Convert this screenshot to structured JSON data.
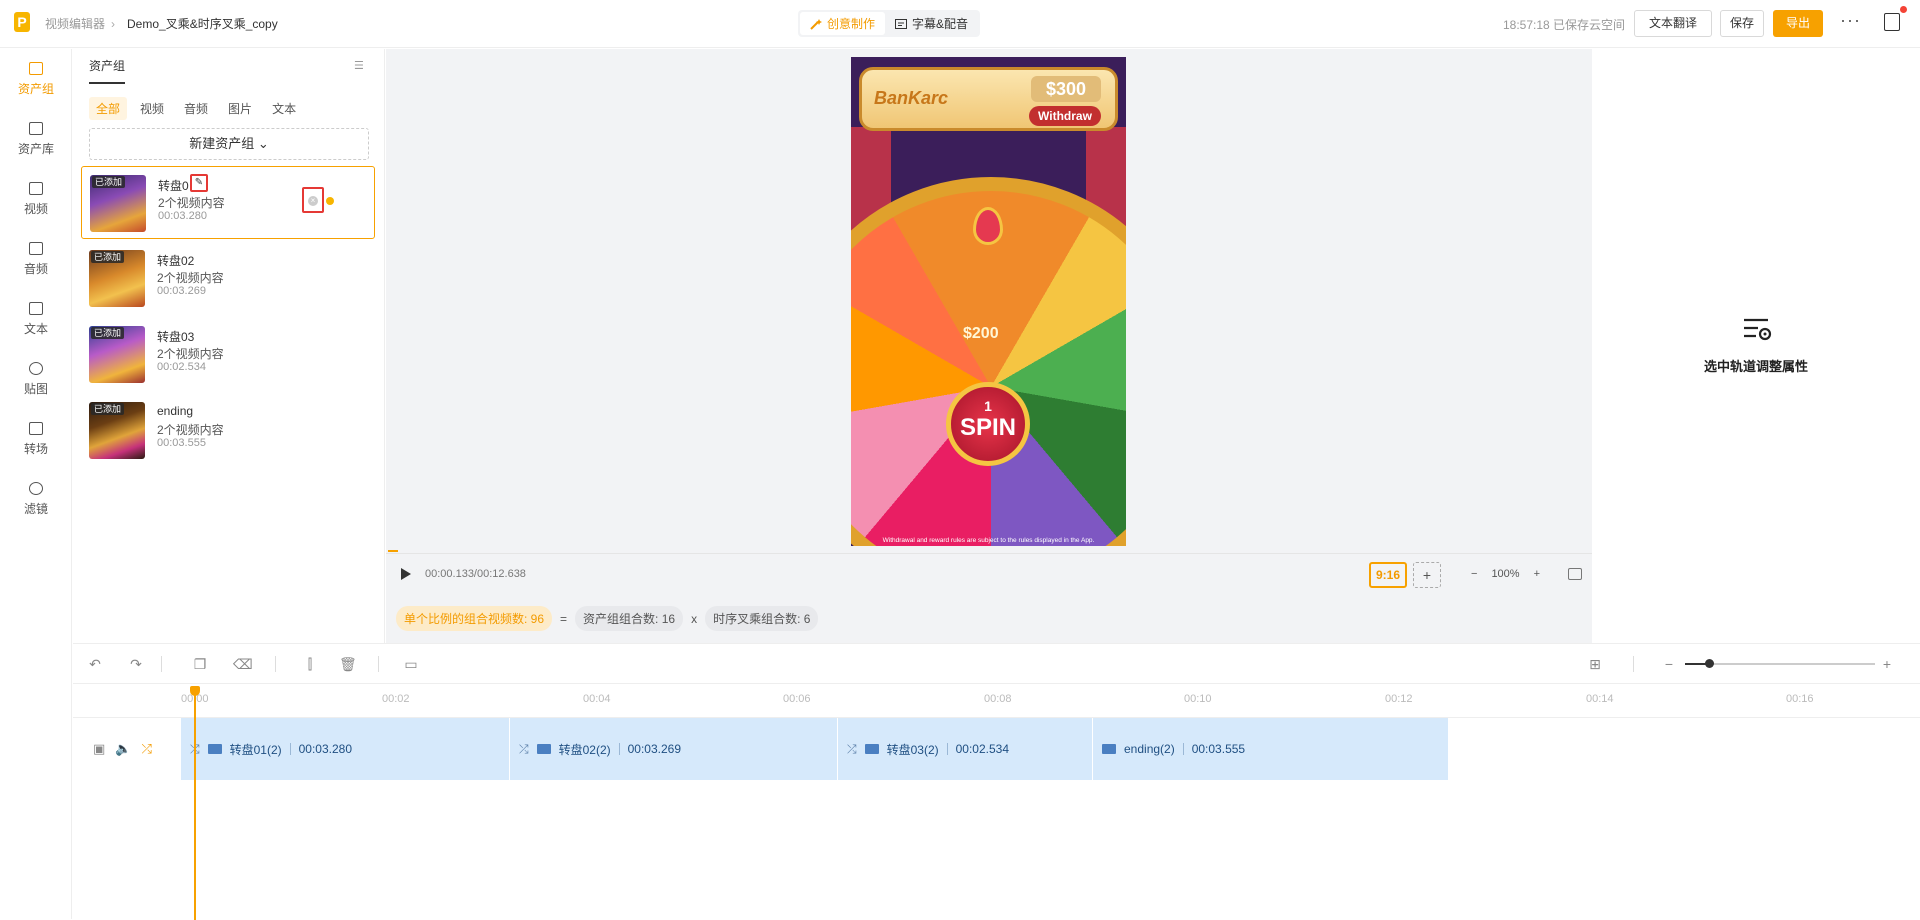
{
  "header": {
    "logo": "P",
    "breadcrumb_app": "视频编辑器",
    "project_name": "Demo_叉乘&时序叉乘_copy",
    "mode_tabs": [
      "创意制作",
      "字幕&配音"
    ],
    "active_mode": "创意制作",
    "save_status": "18:57:18 已保存云空间",
    "translate_label": "文本翻译",
    "save_label": "保存",
    "export_label": "导出",
    "more_label": "···"
  },
  "nav": {
    "items": [
      {
        "label": "资产组",
        "icon": "folder-icon",
        "active": true
      },
      {
        "label": "资产库",
        "icon": "media-library-icon"
      },
      {
        "label": "视频",
        "icon": "film-icon"
      },
      {
        "label": "音频",
        "icon": "music-icon"
      },
      {
        "label": "文本",
        "icon": "text-icon"
      },
      {
        "label": "贴图",
        "icon": "sticker-icon"
      },
      {
        "label": "转场",
        "icon": "transition-icon"
      },
      {
        "label": "滤镜",
        "icon": "filter-icon"
      }
    ]
  },
  "asset_panel": {
    "title": "资产组",
    "filters": [
      "全部",
      "视频",
      "音频",
      "图片",
      "文本"
    ],
    "active_filter": "全部",
    "new_group_label": "新建资产组",
    "assets": [
      {
        "badge": "已添加",
        "name": "转盘0",
        "subtitle": "2个视频内容",
        "duration": "00:03.280",
        "selected": true
      },
      {
        "badge": "已添加",
        "name": "转盘02",
        "subtitle": "2个视频内容",
        "duration": "00:03.269"
      },
      {
        "badge": "已添加",
        "name": "转盘03",
        "subtitle": "2个视频内容",
        "duration": "00:02.534"
      },
      {
        "badge": "已添加",
        "name": "ending",
        "subtitle": "2个视频内容",
        "duration": "00:03.555"
      }
    ]
  },
  "preview": {
    "brand": "BanKarc",
    "amount": "$300",
    "withdraw": "Withdraw",
    "prize": "$200",
    "spin_count": "1",
    "spin_label": "SPIN",
    "footer": "Withdrawal and reward rules are subject to the rules displayed in the App."
  },
  "player": {
    "timecode": "00:00.133/00:12.638",
    "ratio": "9:16",
    "ratio_add": "+",
    "zoom": "100%",
    "zoom_minus": "−",
    "zoom_plus": "+"
  },
  "combo": {
    "total_label": "单个比例的组合视频数: 96",
    "eq": "=",
    "group_label": "资产组组合数: 16",
    "times": "x",
    "seq_label": "时序叉乘组合数: 6"
  },
  "right_panel": {
    "hint": "选中轨道调整属性"
  },
  "timeline": {
    "ticks": [
      "00:00",
      "00:02",
      "00:04",
      "00:06",
      "00:08",
      "00:10",
      "00:12",
      "00:14",
      "00:16"
    ],
    "clips": [
      {
        "name": "转盘01(2)",
        "duration": "00:03.280"
      },
      {
        "name": "转盘02(2)",
        "duration": "00:03.269"
      },
      {
        "name": "转盘03(2)",
        "duration": "00:02.534"
      },
      {
        "name": "ending(2)",
        "duration": "00:03.555"
      }
    ]
  }
}
